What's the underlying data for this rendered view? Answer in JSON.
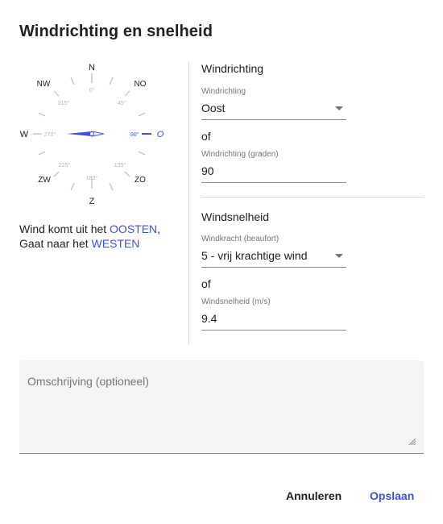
{
  "dialog": {
    "title": "Windrichting en snelheid"
  },
  "compass": {
    "cardinal": {
      "n": "N",
      "ne": "NO",
      "e": "O",
      "se": "ZO",
      "s": "Z",
      "sw": "ZW",
      "w": "W",
      "nw": "NW"
    },
    "degrees": {
      "d0": "0°",
      "d45": "45°",
      "d90": "90°",
      "d135": "135°",
      "d180": "180°",
      "d225": "225°",
      "d270": "270°",
      "d315": "315°"
    },
    "needle_degrees": 90,
    "accent_color": "#3f51d9"
  },
  "description": {
    "line1_prefix": "Wind komt uit het ",
    "line1_highlight": "OOSTEN",
    "line1_suffix": ",",
    "line2_prefix": "Gaat naar het ",
    "line2_highlight": "WESTEN"
  },
  "direction": {
    "section_title": "Windrichting",
    "select_label": "Windrichting",
    "select_value": "Oost",
    "or_label": "of",
    "degrees_label": "Windrichting (graden)",
    "degrees_value": "90"
  },
  "speed": {
    "section_title": "Windsnelheid",
    "beaufort_label": "Windkracht (beaufort)",
    "beaufort_value": "5 - vrij krachtige wind",
    "or_label": "of",
    "ms_label": "Windsnelheid (m/s)",
    "ms_value": "9.4"
  },
  "notes": {
    "placeholder": "Omschrijving (optioneel)"
  },
  "actions": {
    "cancel_label": "Annuleren",
    "save_label": "Opslaan"
  }
}
